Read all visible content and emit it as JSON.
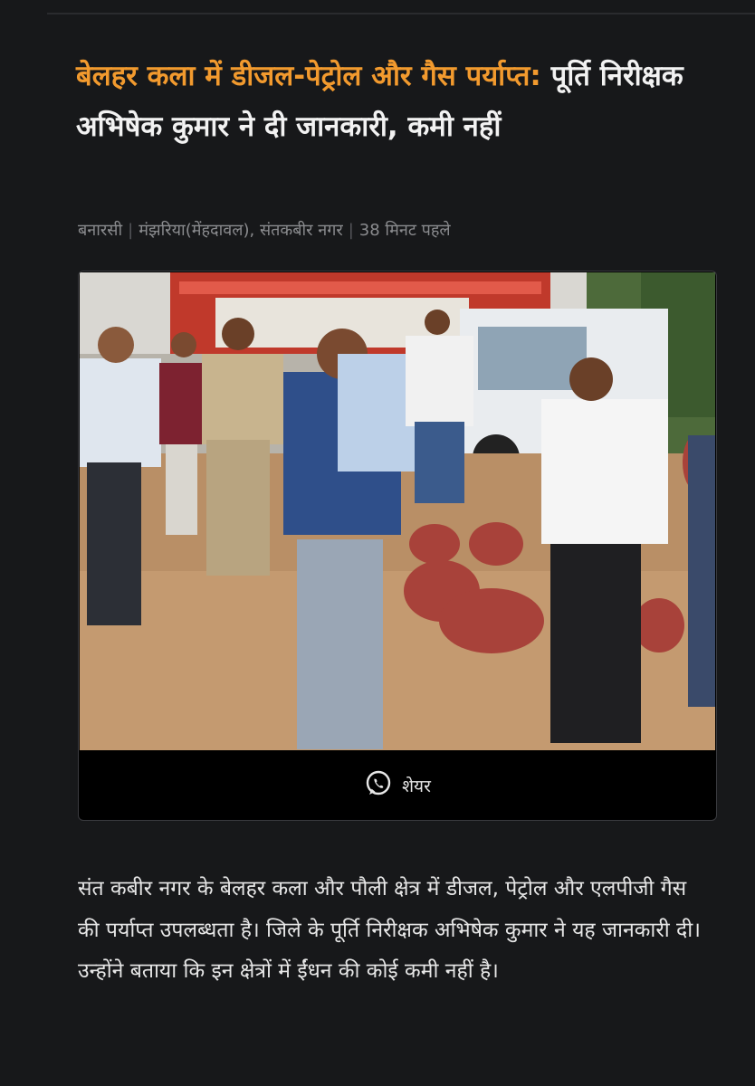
{
  "headline": {
    "accent": "बेलहर कला में डीजल-पेट्रोल और गैस पर्याप्त:",
    "rest": "पूर्ति निरीक्षक अभिषेक कुमार ने दी जानकारी, कमी नहीं"
  },
  "meta": {
    "author": "बनारसी",
    "location": "मंझरिया(मेंहदावल), संतकबीर नगर",
    "time": "38 मिनट पहले"
  },
  "share": {
    "label": "शेयर",
    "icon": "whatsapp-icon"
  },
  "colors": {
    "background": "#17181a",
    "accent": "#f29a2e",
    "meta": "#8a8b8e"
  },
  "article": {
    "body": "संत कबीर नगर के बेलहर कला और पौली क्षेत्र में डीजल, पेट्रोल और एलपीजी गैस की पर्याप्त उपलब्धता है। जिले के पूर्ति निरीक्षक अभिषेक कुमार ने यह जानकारी दी। उन्होंने बताया कि इन क्षेत्रों में ईंधन की कोई कमी नहीं है।"
  }
}
